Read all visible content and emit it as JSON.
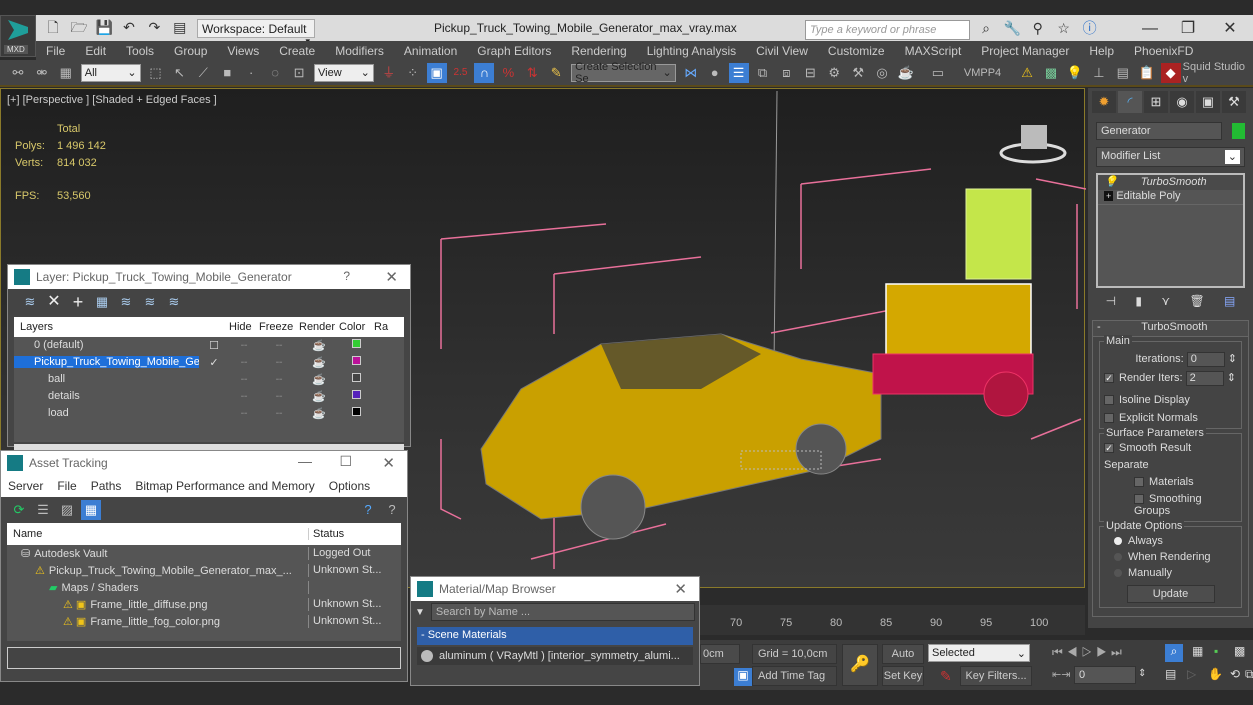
{
  "app": {
    "logo_label": "MXD",
    "workspace": "Workspace: Default",
    "title": "Pickup_Truck_Towing_Mobile_Generator_max_vray.max",
    "search_placeholder": "Type a keyword or phrase",
    "window_controls": [
      "minimize",
      "restore",
      "close"
    ]
  },
  "menu": [
    "File",
    "Edit",
    "Tools",
    "Group",
    "Views",
    "Create",
    "Modifiers",
    "Animation",
    "Graph Editors",
    "Rendering",
    "Lighting Analysis",
    "Civil View",
    "Customize",
    "MAXScript",
    "Project Manager",
    "Help",
    "PhoenixFD"
  ],
  "toolbar": {
    "selection_filter": "All",
    "reference_coord": "View",
    "named_selection": "Create Selection Se",
    "snap_label": "2.5",
    "plugin_label": "VMPP4",
    "squid_label": "Squid Studio v"
  },
  "viewport": {
    "label": "[+] [Perspective ] [Shaded + Edged Faces ]",
    "stats": {
      "header": "Total",
      "polys_label": "Polys:",
      "polys": "1 496 142",
      "verts_label": "Verts:",
      "verts": "814 032",
      "fps_label": "FPS:",
      "fps": "53,560"
    }
  },
  "layer_window": {
    "title": "Layer: Pickup_Truck_Towing_Mobile_Generator",
    "help": "?",
    "columns": [
      "Layers",
      "",
      "Hide",
      "Freeze",
      "Render",
      "Color",
      "Ra"
    ],
    "rows": [
      {
        "name": "0 (default)",
        "current": "box",
        "color": "#33cc33",
        "selected": false,
        "indent": 1
      },
      {
        "name": "Pickup_Truck_Towing_Mobile_Gene",
        "current": "check",
        "color": "#bb1199",
        "selected": true,
        "indent": 1
      },
      {
        "name": "ball",
        "current": "",
        "color": "#444444",
        "selected": false,
        "indent": 2
      },
      {
        "name": "details",
        "current": "",
        "color": "#5522bb",
        "selected": false,
        "indent": 2
      },
      {
        "name": "load",
        "current": "",
        "color": "#000000",
        "selected": false,
        "indent": 2
      }
    ]
  },
  "asset_window": {
    "title": "Asset Tracking",
    "menu": [
      "Server",
      "File",
      "Paths",
      "Bitmap Performance and Memory",
      "Options"
    ],
    "columns": [
      "Name",
      "Status"
    ],
    "rows": [
      {
        "name": "Autodesk Vault",
        "status": "Logged Out",
        "indent": 1,
        "icon": "vault-icon"
      },
      {
        "name": "Pickup_Truck_Towing_Mobile_Generator_max_...",
        "status": "Unknown St...",
        "indent": 2,
        "icon": "warning-icon"
      },
      {
        "name": "Maps / Shaders",
        "status": "",
        "indent": 3,
        "icon": "maps-icon"
      },
      {
        "name": "Frame_little_diffuse.png",
        "status": "Unknown St...",
        "indent": 4,
        "icon": "png-icon"
      },
      {
        "name": "Frame_little_fog_color.png",
        "status": "Unknown St...",
        "indent": 4,
        "icon": "png-icon"
      }
    ]
  },
  "material_browser": {
    "title": "Material/Map Browser",
    "search_placeholder": "Search by Name ...",
    "section": "- Scene Materials",
    "items": [
      "aluminum  ( VRayMtl ) [interior_symmetry_alumi..."
    ]
  },
  "command_panel": {
    "object_name": "Generator",
    "object_color": "#22bb33",
    "modifier_list": "Modifier List",
    "stack": [
      "TurboSmooth",
      "Editable Poly"
    ],
    "rollout_title": "TurboSmooth",
    "main": {
      "label": "Main",
      "iterations_label": "Iterations:",
      "iterations": "0",
      "render_iters_label": "Render Iters:",
      "render_iters": "2",
      "render_iters_checked": true,
      "isoline": "Isoline Display",
      "explicit": "Explicit Normals"
    },
    "surface": {
      "label": "Surface Parameters",
      "smooth_result": "Smooth Result",
      "separate": "Separate",
      "materials": "Materials",
      "smoothing_groups": "Smoothing Groups"
    },
    "update": {
      "label": "Update Options",
      "options": [
        "Always",
        "When Rendering",
        "Manually"
      ],
      "selected": "Always",
      "button": "Update"
    }
  },
  "timeline": {
    "ticks": [
      "70",
      "75",
      "80",
      "85",
      "90",
      "95",
      "100"
    ]
  },
  "status": {
    "unit_partial": "0cm",
    "grid": "Grid = 10,0cm",
    "add_time_tag": "Add Time Tag",
    "auto_key": "Auto Key",
    "set_key": "Set Key",
    "key_mode": "Selected",
    "key_filters": "Key Filters...",
    "frame": "0"
  }
}
